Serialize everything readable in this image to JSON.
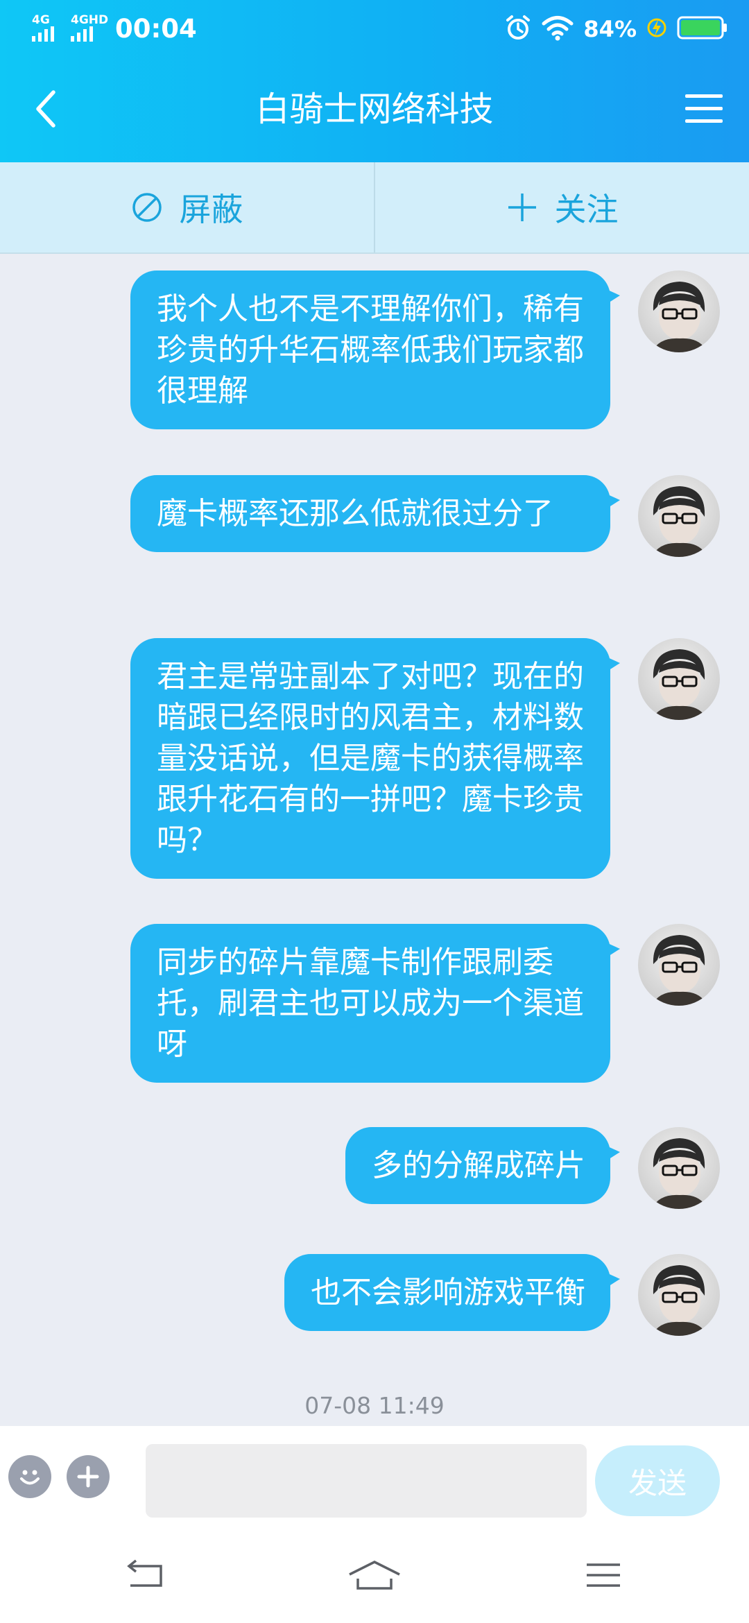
{
  "status_bar": {
    "signal1_label": "4G",
    "signal2_label": "4GHD",
    "time": "00:04",
    "battery_percent": "84%",
    "icons": [
      "signal-icon",
      "signal-icon",
      "alarm-icon",
      "wifi-icon",
      "charging-icon",
      "battery-icon"
    ]
  },
  "header": {
    "title": "白骑士网络科技",
    "back_icon": "chevron-left-icon",
    "menu_icon": "hamburger-menu-icon"
  },
  "actions": {
    "block_label": "屏蔽",
    "block_icon": "block-icon",
    "follow_label": "关注",
    "follow_icon": "plus-icon"
  },
  "messages": [
    {
      "text": "我个人也不是不理解你们，稀有珍贵的升华石概率低我们玩家都很理解"
    },
    {
      "text": "魔卡概率还那么低就很过分了"
    },
    {
      "text": "君主是常驻副本了对吧？现在的暗跟已经限时的风君主，材料数量没话说，但是魔卡的获得概率跟升花石有的一拼吧？魔卡珍贵吗？"
    },
    {
      "text": "同步的碎片靠魔卡制作跟刷委托，刷君主也可以成为一个渠道呀"
    },
    {
      "text": "多的分解成碎片"
    },
    {
      "text": "也不会影响游戏平衡"
    }
  ],
  "timestamp": "07-08 11:49",
  "input_bar": {
    "emoji_icon": "smiley-icon",
    "plus_icon": "plus-circle-icon",
    "input_value": "",
    "send_label": "发送"
  },
  "nav_bar": {
    "icons": [
      "back-nav-icon",
      "home-nav-icon",
      "recents-nav-icon"
    ]
  },
  "colors": {
    "header_start": "#0fc7f6",
    "header_end": "#1a9bf2",
    "bubble": "#25b6f3",
    "chat_background": "#eaedf4",
    "action_bar": "#d2eefa",
    "action_text": "#1aa4dc"
  }
}
